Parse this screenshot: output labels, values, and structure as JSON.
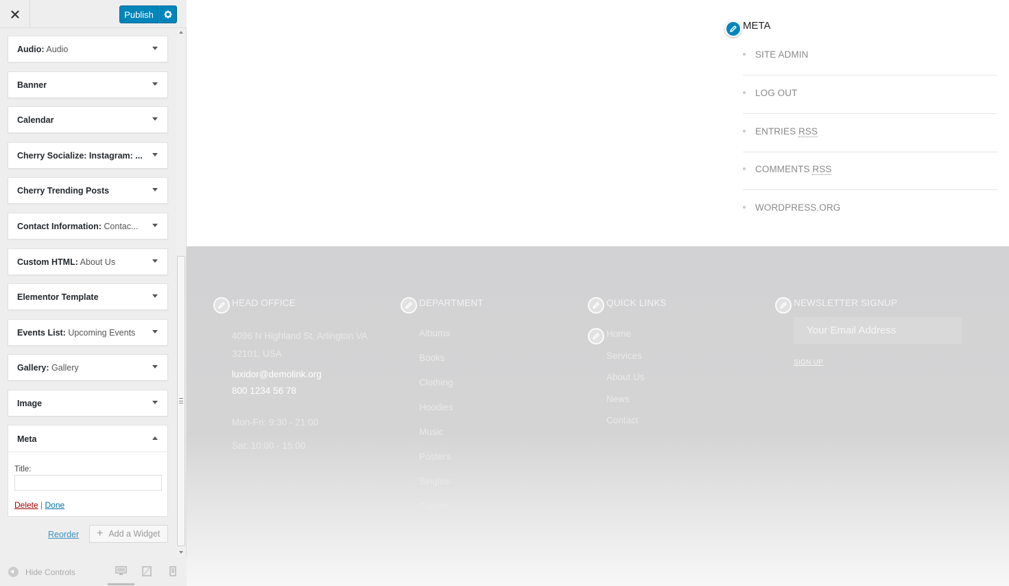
{
  "header": {
    "publish_label": "Publish"
  },
  "widgets": [
    {
      "title": "Audio:",
      "instance": " Audio"
    },
    {
      "title": "Banner",
      "instance": ""
    },
    {
      "title": "Calendar",
      "instance": ""
    },
    {
      "title": "Cherry Socialize: Instagram: ...",
      "instance": ""
    },
    {
      "title": "Cherry Trending Posts",
      "instance": ""
    },
    {
      "title": "Contact Information:",
      "instance": " Contac..."
    },
    {
      "title": "Custom HTML:",
      "instance": " About Us"
    },
    {
      "title": "Elementor Template",
      "instance": ""
    },
    {
      "title": "Events List:",
      "instance": " Upcoming Events"
    },
    {
      "title": "Gallery:",
      "instance": " Gallery"
    },
    {
      "title": "Image",
      "instance": ""
    }
  ],
  "meta_widget": {
    "title": "Meta",
    "field_label": "Title:",
    "field_value": "",
    "delete_label": "Delete",
    "separator": "|",
    "done_label": "Done"
  },
  "panel_actions": {
    "reorder_label": "Reorder",
    "add_widget_label": "Add a Widget"
  },
  "panel_footer": {
    "hide_controls_label": "Hide Controls"
  },
  "preview": {
    "meta_heading": "META",
    "meta_links": [
      {
        "text": "SITE ADMIN",
        "abbr": ""
      },
      {
        "text": "LOG OUT",
        "abbr": ""
      },
      {
        "text": "ENTRIES ",
        "abbr": "RSS"
      },
      {
        "text": "COMMENTS ",
        "abbr": "RSS"
      },
      {
        "text": "WORDPRESS.ORG",
        "abbr": ""
      }
    ],
    "footer": {
      "head_office": {
        "title": "HEAD OFFICE",
        "address_line1": "4096 N Highland St, Arlington VA",
        "address_line2": "32101, USA",
        "email": "luxidor@demolink.org",
        "phone": "800 1234 56 78",
        "hours_weekday": "Mon-Fri: 9:30 - 21:00",
        "hours_saturday": "Sat: 10:00 - 15:00"
      },
      "department": {
        "title": "DEPARTMENT",
        "items": [
          "Albums",
          "Books",
          "Clothing",
          "Hoodies",
          "Music",
          "Posters",
          "Singles",
          "T-shirts"
        ]
      },
      "quick_links": {
        "title": "QUICK LINKS",
        "items": [
          "Home",
          "Services",
          "About Us",
          "News",
          "Contact"
        ]
      },
      "newsletter": {
        "title": "NEWSLETTER SIGNUP",
        "placeholder": "Your Email Address",
        "button_label": "SIGN UP"
      }
    }
  },
  "colors": {
    "primary": "#0085ba",
    "link": "#0073aa",
    "delete": "#aa0000",
    "footer_bg": "#d2d2d4"
  }
}
